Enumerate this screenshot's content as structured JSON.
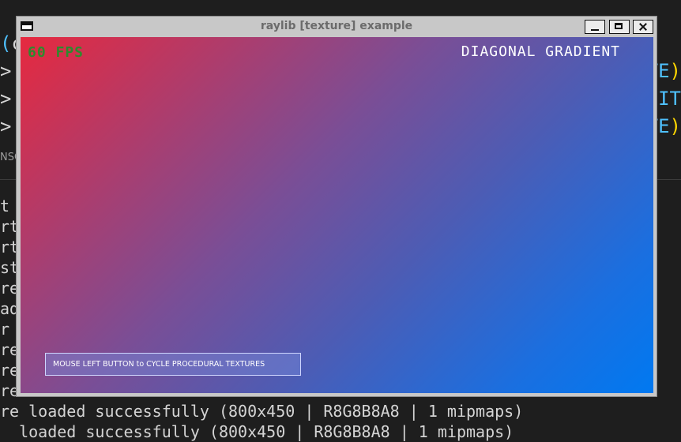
{
  "terminal": {
    "left_code_line": "(",
    "left_code_frag": "c",
    "right_lines": [
      {
        "text": "TE",
        "paren": ")"
      },
      {
        "text": "HIT",
        "paren": ""
      },
      {
        "text": "TE",
        "paren": ")"
      }
    ],
    "left_arrows": [
      "> ",
      "> ",
      "> "
    ],
    "panel_label": "NSC",
    "output_fragments": [
      "t",
      "rt",
      "rt",
      "st",
      "re",
      "ad",
      "r",
      "re",
      "re",
      "re"
    ],
    "bottom_line": "re loaded successfully (800x450 | R8G8B8A8 | 1 mipmaps)",
    "bottom_line_partial": "  loaded successfully (800x450 | R8G8B8A8 | 1 mipmaps)"
  },
  "window": {
    "title": "raylib [texture] example",
    "controls": {
      "minimize": "minimize",
      "maximize": "maximize",
      "close": "close"
    }
  },
  "canvas": {
    "fps": "60 FPS",
    "texture_name": "DIAGONAL GRADIENT",
    "hint": "MOUSE LEFT BUTTON to CYCLE PROCEDURAL TEXTURES",
    "gradient_colors": [
      "#e6293f",
      "#0079f1"
    ]
  }
}
